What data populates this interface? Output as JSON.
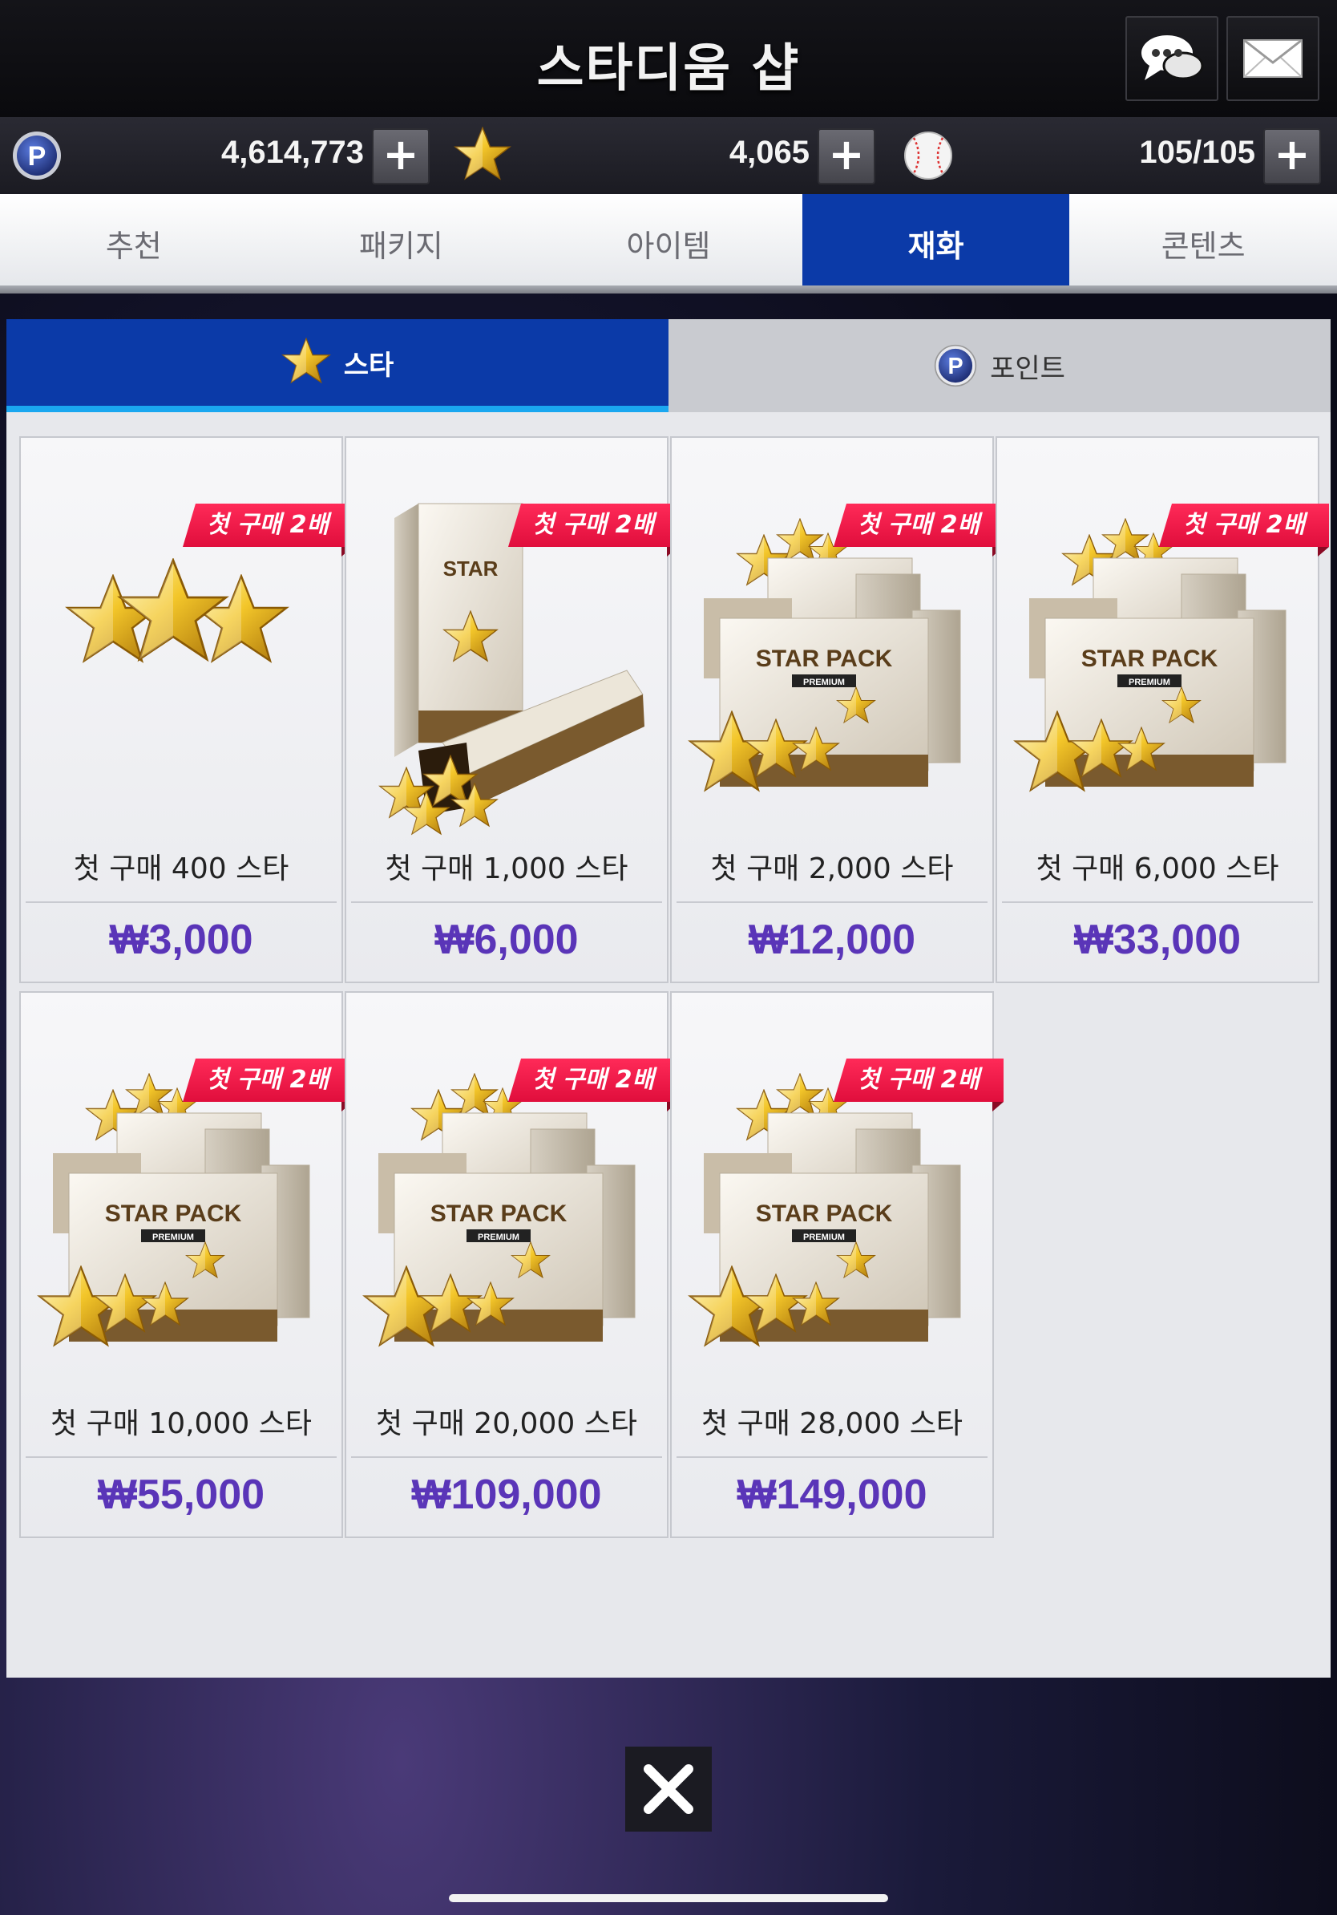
{
  "header": {
    "title": "스타디움 샵",
    "chat_icon": "chat-bubble-icon",
    "mail_icon": "envelope-icon"
  },
  "currencies": [
    {
      "icon": "point-coin-icon",
      "value": "4,614,773"
    },
    {
      "icon": "star-icon",
      "value": "4,065"
    },
    {
      "icon": "baseball-icon",
      "value": "105/105"
    }
  ],
  "plus_label": "+",
  "main_tabs": [
    {
      "label": "추천"
    },
    {
      "label": "패키지"
    },
    {
      "label": "아이템"
    },
    {
      "label": "재화",
      "active": true
    },
    {
      "label": "콘텐츠"
    }
  ],
  "sub_tabs": [
    {
      "label": "스타",
      "icon": "star-icon",
      "active": true
    },
    {
      "label": "포인트",
      "icon": "point-coin-icon"
    }
  ],
  "badge_text": "첫 구매 2배",
  "products": [
    {
      "name": "첫 구매 400 스타",
      "price": "₩3,000",
      "image": "stars-cluster"
    },
    {
      "name": "첫 구매 1,000 스타",
      "price": "₩6,000",
      "image": "star-pack-box"
    },
    {
      "name": "첫 구매 2,000 스타",
      "price": "₩12,000",
      "image": "premium-star-pack"
    },
    {
      "name": "첫 구매 6,000 스타",
      "price": "₩33,000",
      "image": "premium-star-pack"
    },
    {
      "name": "첫 구매 10,000 스타",
      "price": "₩55,000",
      "image": "premium-star-pack"
    },
    {
      "name": "첫 구매 20,000 스타",
      "price": "₩109,000",
      "image": "premium-star-pack"
    },
    {
      "name": "첫 구매 28,000 스타",
      "price": "₩149,000",
      "image": "premium-star-pack"
    }
  ],
  "pack_label_1": "STAR",
  "pack_label_2": "PACK",
  "pack_premium": "PREMIUM",
  "colors": {
    "active_tab": "#0b3aa8",
    "tab_underline": "#1aa7f0",
    "badge": "#f0174a",
    "price": "#5a35b8"
  }
}
